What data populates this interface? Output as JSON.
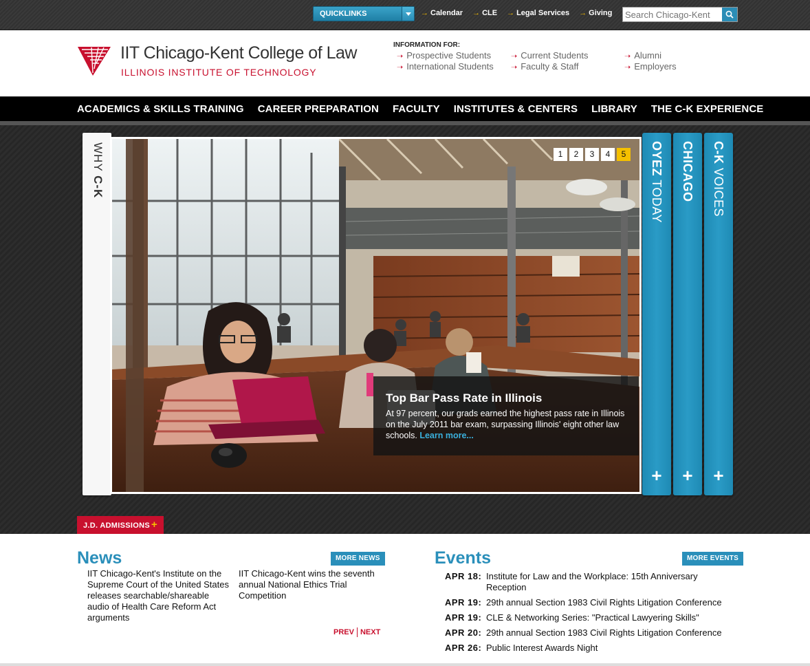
{
  "topbar": {
    "quicklinks_label": "QUICKLINKS",
    "links": [
      "Calendar",
      "CLE",
      "Legal Services",
      "Giving"
    ],
    "search_placeholder": "Search Chicago-Kent"
  },
  "header": {
    "title": "IIT Chicago-Kent College of Law",
    "subtitle": "ILLINOIS INSTITUTE OF TECHNOLOGY",
    "info_label": "INFORMATION FOR:",
    "info_links": [
      "Prospective Students",
      "International Students",
      "Current Students",
      "Faculty & Staff",
      "Alumni",
      "Employers"
    ]
  },
  "nav": {
    "items": [
      "ACADEMICS & SKILLS TRAINING",
      "CAREER PREPARATION",
      "FACULTY",
      "INSTITUTES & CENTERS",
      "LIBRARY",
      "THE C-K EXPERIENCE"
    ]
  },
  "hero": {
    "why_tab_prefix": "WHY ",
    "why_tab_bold": "C-K",
    "pager": [
      "1",
      "2",
      "3",
      "4",
      "5"
    ],
    "pager_active": 5,
    "caption_title": "Top Bar Pass Rate in Illinois",
    "caption_text": "At 97 percent, our grads earned the highest pass rate in Illinois on the July 2011 bar exam, surpassing Illinois' eight other law schools.",
    "caption_link": "Learn more...",
    "side_tabs": [
      {
        "bold": "OYEZ",
        "rest": " TODAY"
      },
      {
        "bold": "CHICAGO",
        "rest": ""
      },
      {
        "bold": "C-K",
        "rest": " VOICES"
      }
    ],
    "plus": "+"
  },
  "jd_admissions": "J.D. ADMISSIONS",
  "news": {
    "title": "News",
    "more": "MORE NEWS",
    "items": [
      "IIT Chicago-Kent's Institute on the Supreme Court of the United States releases searchable/shareable audio of Health Care Reform Act arguments",
      "IIT Chicago-Kent wins the seventh annual National Ethics Trial Competition"
    ],
    "prev": "PREV",
    "next": "NEXT"
  },
  "events": {
    "title": "Events",
    "more": "MORE EVENTS",
    "items": [
      {
        "date": "APR 18:",
        "title": "Institute for Law and the Workplace: 15th Anniversary Reception"
      },
      {
        "date": "APR 19:",
        "title": "29th annual Section 1983 Civil Rights Litigation Conference"
      },
      {
        "date": "APR 19:",
        "title": "CLE & Networking Series: \"Practical Lawyering Skills\""
      },
      {
        "date": "APR 20:",
        "title": "29th annual Section 1983 Civil Rights Litigation Conference"
      },
      {
        "date": "APR 26:",
        "title": "Public Interest Awards Night"
      }
    ]
  },
  "colors": {
    "brand_red": "#c8102e",
    "accent_blue": "#2a8fba",
    "highlight_yellow": "#f5c000"
  }
}
